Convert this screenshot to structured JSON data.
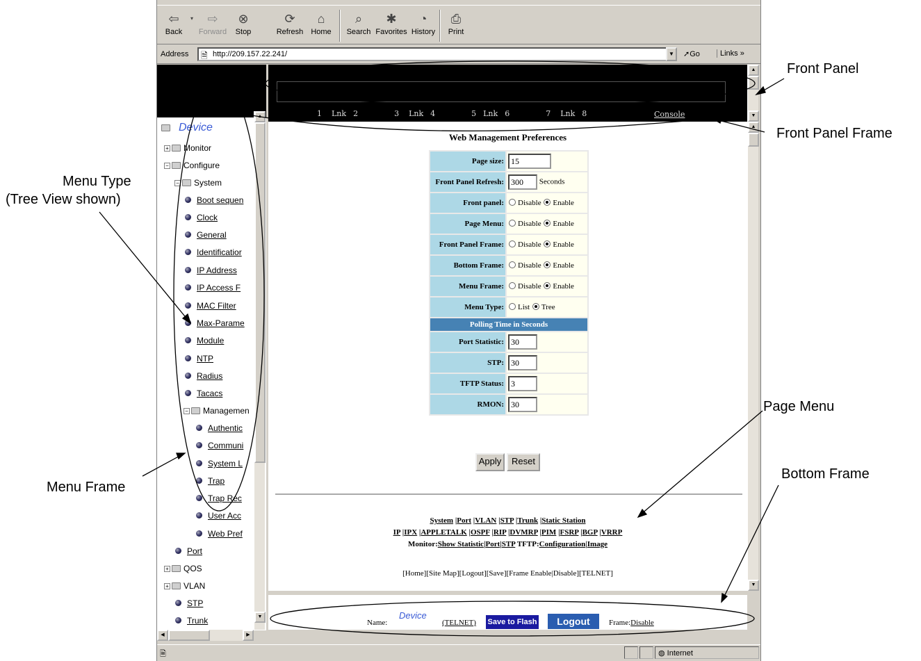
{
  "toolbar": {
    "back": "Back",
    "forward": "Forward",
    "stop": "Stop",
    "refresh": "Refresh",
    "home": "Home",
    "search": "Search",
    "favorites": "Favorites",
    "history": "History",
    "print": "Print"
  },
  "address": {
    "label": "Address",
    "url": "http://209.157.22.241/",
    "go": "Go",
    "links": "Links"
  },
  "front_panel": {
    "ports": [
      "1",
      "Lnk",
      "2",
      "3",
      "Lnk",
      "4",
      "5",
      "Lnk",
      "6",
      "7",
      "Lnk",
      "8"
    ],
    "console": "Console"
  },
  "menu": {
    "root": "Device",
    "monitor": "Monitor",
    "configure": "Configure",
    "system": "System",
    "system_items": [
      "Boot sequen",
      "Clock",
      "General",
      "Identificatior",
      "IP Address",
      "IP Access F",
      "MAC Filter",
      "Max-Parame",
      "Module",
      "NTP",
      "Radius",
      "Tacacs"
    ],
    "management": "Managemen",
    "management_items": [
      "Authentic",
      "Communi",
      "System L",
      "Trap",
      "Trap Rec",
      "User Acc",
      "Web Pref"
    ],
    "port": "Port",
    "qos": "QOS",
    "vlan": "VLAN",
    "stp": "STP",
    "trunk": "Trunk"
  },
  "prefs": {
    "title": "Web Management Preferences",
    "page_size_label": "Page size:",
    "page_size": "15",
    "refresh_label": "Front Panel Refresh:",
    "refresh": "300",
    "seconds": "Seconds",
    "front_panel_label": "Front panel:",
    "page_menu_label": "Page Menu:",
    "fp_frame_label": "Front Panel Frame:",
    "bottom_frame_label": "Bottom Frame:",
    "menu_frame_label": "Menu Frame:",
    "menu_type_label": "Menu Type:",
    "disable": "Disable",
    "enable": "Enable",
    "list": "List",
    "tree": "Tree",
    "polling_header": "Polling Time in Seconds",
    "port_stat_label": "Port Statistic:",
    "port_stat": "30",
    "stp_label": "STP:",
    "stp": "30",
    "tftp_label": "TFTP Status:",
    "tftp": "3",
    "rmon_label": "RMON:",
    "rmon": "30",
    "apply": "Apply",
    "reset": "Reset"
  },
  "page_menu": {
    "line1": [
      "System",
      "Port",
      "VLAN",
      "STP",
      "Trunk",
      "Static Station"
    ],
    "line2": [
      "IP",
      "IPX",
      "APPLETALK",
      "OSPF",
      "RIP",
      "DVMRP",
      "PIM",
      "FSRP",
      "BGP",
      "VRRP"
    ],
    "monitor_prefix": "Monitor:",
    "monitor_links": [
      "Show Statistic",
      "Port",
      "STP"
    ],
    "tftp_prefix": "TFTP:",
    "tftp_links": [
      "Configuration",
      "Image"
    ],
    "home_line": "[Home][Site Map][Logout][Save][Frame Enable|Disable][TELNET]"
  },
  "bottom": {
    "name_label": "Name:",
    "device": "Device",
    "telnet": "(TELNET)",
    "save": "Save to Flash",
    "logout": "Logout",
    "frame_label": "Frame:",
    "frame_disable": "Disable"
  },
  "status": {
    "zone": "Internet"
  },
  "annotations": {
    "front_panel": "Front Panel",
    "front_panel_frame": "Front Panel Frame",
    "menu_type_line1": "Menu Type",
    "menu_type_line2": "(Tree View shown)",
    "page_menu": "Page Menu",
    "bottom_frame": "Bottom Frame",
    "menu_frame": "Menu Frame"
  },
  "colors": {
    "label_cell": "#add8e6",
    "value_cell": "#fffff0",
    "header_cell": "#4682b4",
    "save_btn": "#1a1aa0",
    "logout_btn": "#2a5db0",
    "tree_root": "#3a5bd6"
  }
}
